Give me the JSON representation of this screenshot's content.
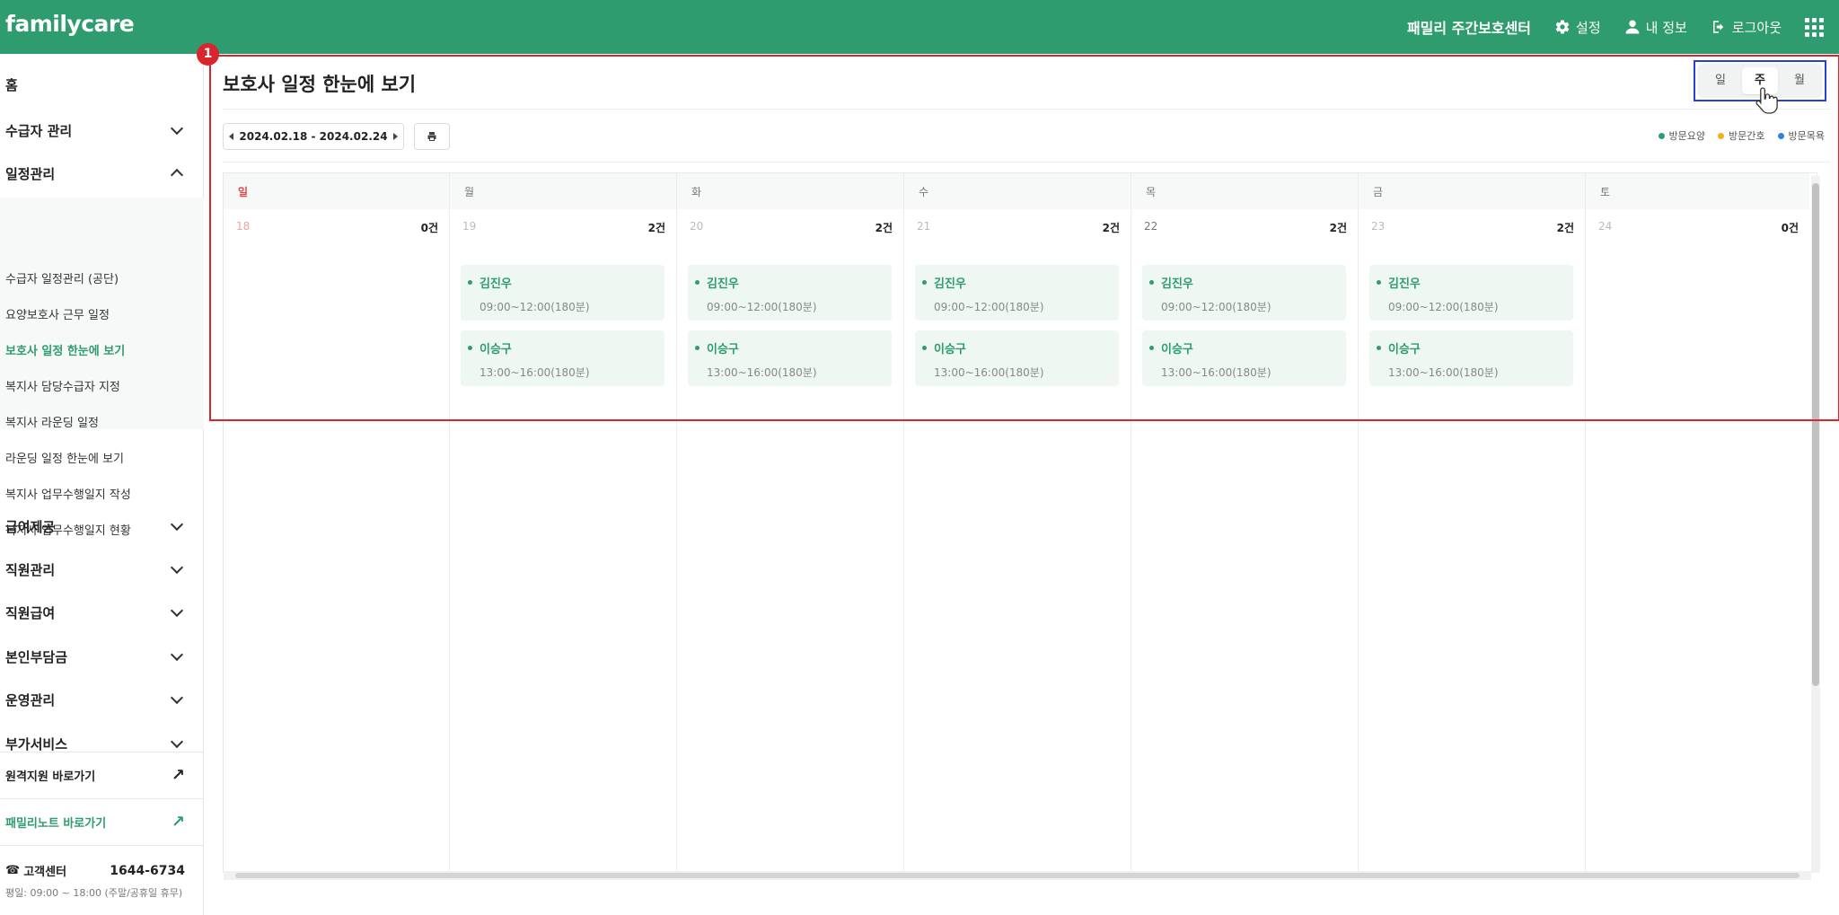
{
  "header": {
    "logo": "familycare",
    "center_name": "패밀리 주간보호센터",
    "settings": "설정",
    "my_info": "내 정보",
    "logout": "로그아웃"
  },
  "sidebar": {
    "home": "홈",
    "groups": [
      {
        "label": "수급자 관리"
      },
      {
        "label": "일정관리"
      },
      {
        "label": "급여제공"
      },
      {
        "label": "직원관리"
      },
      {
        "label": "직원급여"
      },
      {
        "label": "본인부담금"
      },
      {
        "label": "운영관리"
      },
      {
        "label": "부가서비스"
      }
    ],
    "sub_items": [
      {
        "label": "수급자 일정관리 (공단)"
      },
      {
        "label": "요양보호사 근무 일정"
      },
      {
        "label": "보호사 일정 한눈에 보기"
      },
      {
        "label": "복지사 담당수급자 지정"
      },
      {
        "label": "복지사 라운딩 일정"
      },
      {
        "label": "라운딩 일정 한눈에 보기"
      },
      {
        "label": "복지사 업무수행일지 작성"
      },
      {
        "label": "복지사 업무수행일지 현황"
      }
    ],
    "remote_support": "원격지원 바로가기",
    "family_note": "패밀리노트 바로가기",
    "customer_center_label": "고객센터",
    "customer_center_phone": "1644-6734",
    "customer_center_hours": "평일: 09:00 ~ 18:00 (주말/공휴일 휴무)"
  },
  "main": {
    "title": "보호사 일정 한눈에 보기",
    "view_toggle": {
      "day": "일",
      "week": "주",
      "month": "월",
      "selected": "주"
    },
    "date_range": "2024.02.18 - 2024.02.24",
    "legend": [
      {
        "label": "방문요양",
        "color": "#2e9c6e"
      },
      {
        "label": "방문간호",
        "color": "#f2b01e"
      },
      {
        "label": "방문목욕",
        "color": "#2f7fe6"
      }
    ],
    "days": [
      {
        "name": "일",
        "date": "18",
        "count": "0건",
        "events": []
      },
      {
        "name": "월",
        "date": "19",
        "count": "2건",
        "events": [
          {
            "name": "김진우",
            "time": "09:00~12:00(180분)"
          },
          {
            "name": "이승구",
            "time": "13:00~16:00(180분)"
          }
        ]
      },
      {
        "name": "화",
        "date": "20",
        "count": "2건",
        "events": [
          {
            "name": "김진우",
            "time": "09:00~12:00(180분)"
          },
          {
            "name": "이승구",
            "time": "13:00~16:00(180분)"
          }
        ]
      },
      {
        "name": "수",
        "date": "21",
        "count": "2건",
        "events": [
          {
            "name": "김진우",
            "time": "09:00~12:00(180분)"
          },
          {
            "name": "이승구",
            "time": "13:00~16:00(180분)"
          }
        ]
      },
      {
        "name": "목",
        "date": "22",
        "count": "2건",
        "events": [
          {
            "name": "김진우",
            "time": "09:00~12:00(180분)"
          },
          {
            "name": "이승구",
            "time": "13:00~16:00(180분)"
          }
        ]
      },
      {
        "name": "금",
        "date": "23",
        "count": "2건",
        "events": [
          {
            "name": "김진우",
            "time": "09:00~12:00(180분)"
          },
          {
            "name": "이승구",
            "time": "13:00~16:00(180분)"
          }
        ]
      },
      {
        "name": "토",
        "date": "24",
        "count": "0건",
        "events": []
      }
    ]
  },
  "annotation": {
    "badge": "1"
  },
  "colors": {
    "brand": "#2e9c6e",
    "annotation_red": "#d9262c",
    "annotation_blue": "#2442d6",
    "sunday": "#e5484d"
  }
}
